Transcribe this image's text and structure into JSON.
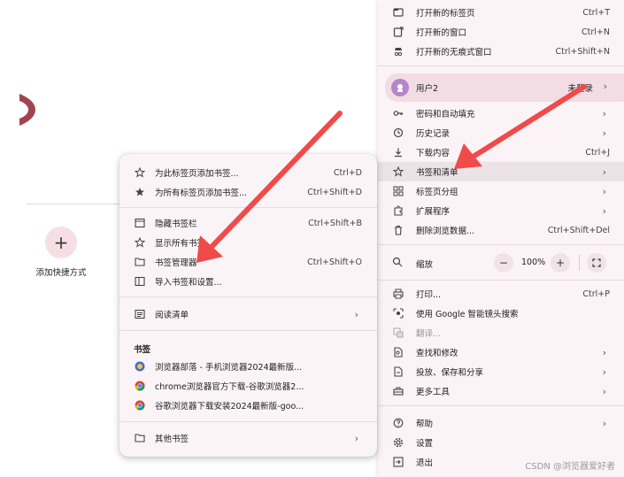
{
  "new_tab": {
    "add_shortcut_label": "添加快捷方式",
    "add_shortcut_icon": "plus-icon"
  },
  "main_menu": {
    "top_items": [
      {
        "label": "打开新的标签页",
        "shortcut": "Ctrl+T",
        "icon": "new-tab-icon"
      },
      {
        "label": "打开新的窗口",
        "shortcut": "Ctrl+N",
        "icon": "new-window-icon"
      },
      {
        "label": "打开新的无痕式窗口",
        "shortcut": "Ctrl+Shift+N",
        "icon": "incognito-icon"
      }
    ],
    "profile": {
      "name": "用户2",
      "state": "未登录"
    },
    "items_a": [
      {
        "label": "密码和自动填充",
        "shortcut": "",
        "icon": "key-icon",
        "submenu": true
      },
      {
        "label": "历史记录",
        "shortcut": "",
        "icon": "history-icon",
        "submenu": true
      },
      {
        "label": "下载内容",
        "shortcut": "Ctrl+J",
        "icon": "download-icon",
        "submenu": false
      },
      {
        "label": "书签和清单",
        "shortcut": "",
        "icon": "star-icon",
        "submenu": true
      },
      {
        "label": "标签页分组",
        "shortcut": "",
        "icon": "tab-groups-icon",
        "submenu": true
      },
      {
        "label": "扩展程序",
        "shortcut": "",
        "icon": "extension-icon",
        "submenu": true
      },
      {
        "label": "删除浏览数据...",
        "shortcut": "Ctrl+Shift+Del",
        "icon": "trash-icon",
        "submenu": false
      }
    ],
    "zoom": {
      "label": "缩放",
      "value": "100%",
      "minus": "−",
      "plus": "+"
    },
    "items_b": [
      {
        "label": "打印...",
        "shortcut": "Ctrl+P",
        "icon": "print-icon",
        "submenu": false
      },
      {
        "label": "使用 Google 智能镜头搜索",
        "shortcut": "",
        "icon": "lens-icon",
        "submenu": false
      },
      {
        "label": "翻译...",
        "shortcut": "",
        "icon": "translate-icon",
        "submenu": false
      },
      {
        "label": "查找和修改",
        "shortcut": "",
        "icon": "find-icon",
        "submenu": true
      },
      {
        "label": "投放、保存和分享",
        "shortcut": "",
        "icon": "cast-icon",
        "submenu": true
      },
      {
        "label": "更多工具",
        "shortcut": "",
        "icon": "toolbox-icon",
        "submenu": true
      }
    ],
    "items_c": [
      {
        "label": "帮助",
        "shortcut": "",
        "icon": "help-icon",
        "submenu": true
      },
      {
        "label": "设置",
        "shortcut": "",
        "icon": "gear-icon",
        "submenu": false
      },
      {
        "label": "退出",
        "shortcut": "",
        "icon": "exit-icon",
        "submenu": false
      }
    ]
  },
  "bookmarks_menu": {
    "group1": [
      {
        "label": "为此标签页添加书签...",
        "shortcut": "Ctrl+D",
        "icon": "star-outline-icon"
      },
      {
        "label": "为所有标签页添加书签...",
        "shortcut": "Ctrl+Shift+D",
        "icon": "star-plus-icon"
      }
    ],
    "group2": [
      {
        "label": "隐藏书签栏",
        "shortcut": "Ctrl+Shift+B",
        "icon": "bookmark-bar-icon"
      },
      {
        "label": "显示所有书签",
        "shortcut": "",
        "icon": "star-list-icon"
      },
      {
        "label": "书签管理器",
        "shortcut": "Ctrl+Shift+O",
        "icon": "bookmark-manager-icon"
      },
      {
        "label": "导入书签和设置...",
        "shortcut": "",
        "icon": "import-icon"
      }
    ],
    "reading_list": {
      "label": "阅读清单",
      "icon": "reading-list-icon"
    },
    "section_title": "书签",
    "bookmarks": [
      {
        "label": "浏览器部落 - 手机浏览器2024最新版...",
        "icon": "site-favicon-icon"
      },
      {
        "label": "chrome浏览器官方下载-谷歌浏览器2...",
        "icon": "chrome-favicon-icon"
      },
      {
        "label": "谷歌浏览器下载安装2024最新版-goo...",
        "icon": "chrome-favicon-icon"
      }
    ],
    "other": {
      "label": "其他书签",
      "icon": "folder-icon"
    }
  },
  "watermark": "CSDN @浏览器爱好者",
  "colors": {
    "menu_bg": "#fbf3f5",
    "highlight": "#ece3e6",
    "profile_bg": "#f1dde3",
    "avatar": "#b784c9",
    "arrow": "#f04a4a"
  }
}
